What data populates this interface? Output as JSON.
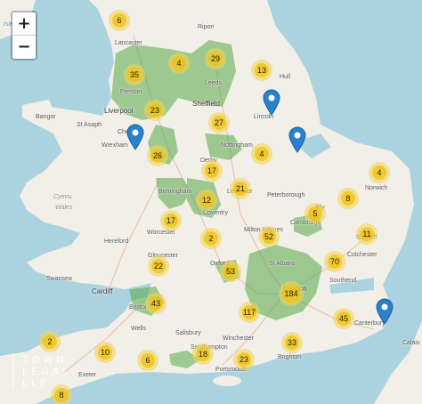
{
  "controls": {
    "zoom_in": "+",
    "zoom_out": "−"
  },
  "watermark": {
    "line1": "TOWN",
    "line2": "LEGAL",
    "line3": "LLP"
  },
  "places": [
    {
      "name": "Isle of Man",
      "kind": "sea"
    },
    {
      "name": "Lancaster",
      "kind": "place"
    },
    {
      "name": "Ripon",
      "kind": "place"
    },
    {
      "name": "Preston",
      "kind": "place"
    },
    {
      "name": "Leeds",
      "kind": "place"
    },
    {
      "name": "Hull",
      "kind": "place"
    },
    {
      "name": "Liverpool",
      "kind": "city"
    },
    {
      "name": "Sheffield",
      "kind": "city"
    },
    {
      "name": "Bangor",
      "kind": "place"
    },
    {
      "name": "St Asaph",
      "kind": "place"
    },
    {
      "name": "Chester",
      "kind": "place"
    },
    {
      "name": "Lincoln",
      "kind": "place"
    },
    {
      "name": "Wrexham",
      "kind": "place"
    },
    {
      "name": "Nottingham",
      "kind": "place"
    },
    {
      "name": "Derby",
      "kind": "place"
    },
    {
      "name": "Cymru",
      "kind": "country"
    },
    {
      "name": "Wales",
      "kind": "country"
    },
    {
      "name": "Birmingham",
      "kind": "place"
    },
    {
      "name": "Leicester",
      "kind": "place"
    },
    {
      "name": "Peterborough",
      "kind": "place"
    },
    {
      "name": "Norwich",
      "kind": "place"
    },
    {
      "name": "Coventry",
      "kind": "place"
    },
    {
      "name": "Ely",
      "kind": "place"
    },
    {
      "name": "Cambridge",
      "kind": "place"
    },
    {
      "name": "Hereford",
      "kind": "place"
    },
    {
      "name": "Worcester",
      "kind": "place"
    },
    {
      "name": "Milton Keynes",
      "kind": "place"
    },
    {
      "name": "Ipswich",
      "kind": "place"
    },
    {
      "name": "Gloucester",
      "kind": "place"
    },
    {
      "name": "Colchester",
      "kind": "place"
    },
    {
      "name": "Swansea",
      "kind": "place"
    },
    {
      "name": "Oxford",
      "kind": "place"
    },
    {
      "name": "St Albans",
      "kind": "place"
    },
    {
      "name": "Southend",
      "kind": "place"
    },
    {
      "name": "Cardiff",
      "kind": "city"
    },
    {
      "name": "Bristol",
      "kind": "place"
    },
    {
      "name": "London",
      "kind": "city"
    },
    {
      "name": "Wells",
      "kind": "place"
    },
    {
      "name": "Salisbury",
      "kind": "place"
    },
    {
      "name": "Winchester",
      "kind": "place"
    },
    {
      "name": "Canterbury",
      "kind": "place"
    },
    {
      "name": "Southampton",
      "kind": "place"
    },
    {
      "name": "Brighton",
      "kind": "place"
    },
    {
      "name": "Exeter",
      "kind": "place"
    },
    {
      "name": "Portsmouth",
      "kind": "place"
    },
    {
      "name": "Calais",
      "kind": "place"
    }
  ],
  "clusters": [
    {
      "count": "6"
    },
    {
      "count": "4"
    },
    {
      "count": "29"
    },
    {
      "count": "13"
    },
    {
      "count": "35"
    },
    {
      "count": "23"
    },
    {
      "count": "27"
    },
    {
      "count": "26"
    },
    {
      "count": "4"
    },
    {
      "count": "17"
    },
    {
      "count": "4"
    },
    {
      "count": "21"
    },
    {
      "count": "12"
    },
    {
      "count": "8"
    },
    {
      "count": "17"
    },
    {
      "count": "5"
    },
    {
      "count": "2"
    },
    {
      "count": "52"
    },
    {
      "count": "11"
    },
    {
      "count": "22"
    },
    {
      "count": "70"
    },
    {
      "count": "53"
    },
    {
      "count": "184"
    },
    {
      "count": "43"
    },
    {
      "count": "117"
    },
    {
      "count": "45"
    },
    {
      "count": "2"
    },
    {
      "count": "33"
    },
    {
      "count": "10"
    },
    {
      "count": "6"
    },
    {
      "count": "18"
    },
    {
      "count": "23"
    },
    {
      "count": "8"
    }
  ],
  "markers": [
    {
      "label": "office-marker"
    },
    {
      "label": "office-marker"
    },
    {
      "label": "office-marker"
    },
    {
      "label": "office-marker"
    }
  ],
  "colors": {
    "sea": "#aad3df",
    "land": "#f2efe9",
    "coverage": "#57a846",
    "cluster_outer": "#f1d357",
    "cluster_inner": "#f0c20c",
    "marker": "#2a81cb"
  }
}
